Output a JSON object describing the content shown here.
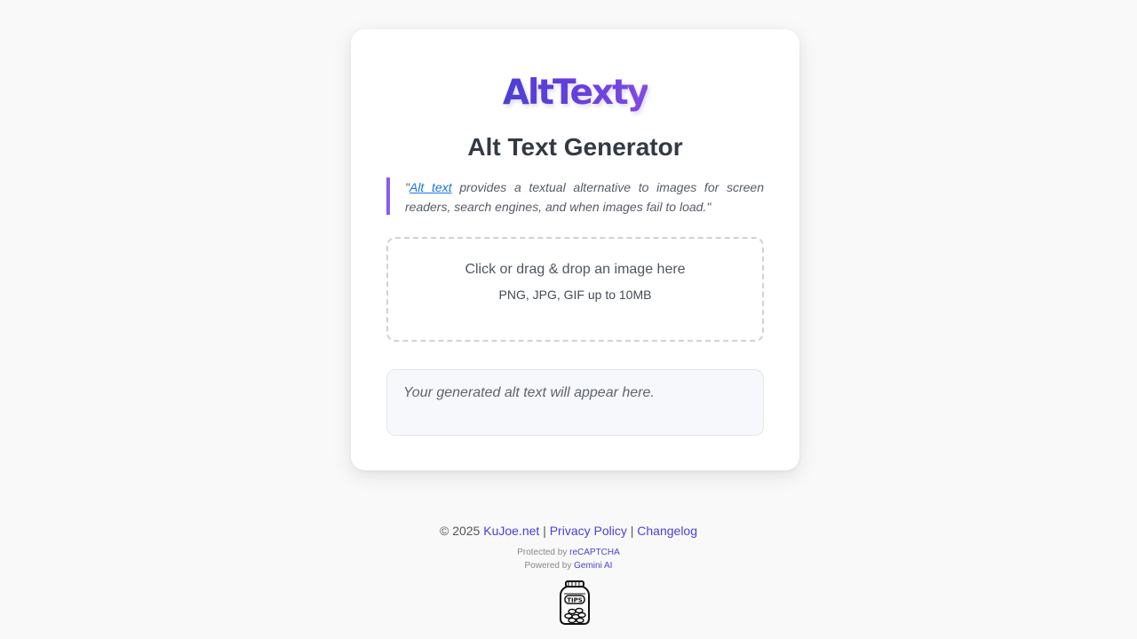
{
  "logo": {
    "text": "AltTexty"
  },
  "page_title": "Alt Text Generator",
  "quote": {
    "open": "\"",
    "link_text": "Alt text",
    "rest": " provides a textual alternative to images for screen readers, search engines, and when images fail to load.\""
  },
  "dropzone": {
    "main_text": "Click or drag & drop an image here",
    "sub_text": "PNG, JPG, GIF up to 10MB"
  },
  "output": {
    "placeholder": "Your generated alt text will appear here."
  },
  "footer": {
    "copyright": "© 2025",
    "site_link": "KuJoe.net",
    "separator": "|",
    "privacy_link": "Privacy Policy",
    "changelog_link": "Changelog",
    "protected_prefix": "Protected by",
    "recaptcha_link": "reCAPTCHA",
    "powered_prefix": "Powered by",
    "gemini_link": "Gemini AI",
    "tips_jar_label": "TIPS"
  },
  "colors": {
    "brand": "#5a3fdc",
    "accent_border": "#8a5cf0",
    "link": "#1a73e8",
    "page_bg": "#f9f9fa"
  },
  "icons": {
    "tips_jar": "tips-jar-icon"
  }
}
